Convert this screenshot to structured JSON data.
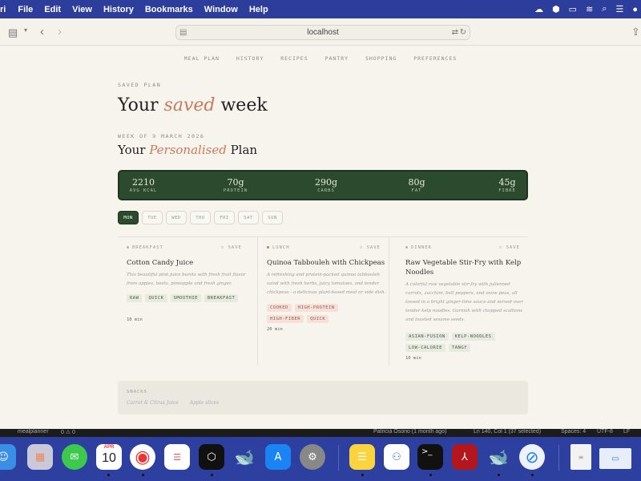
{
  "menubar": {
    "app": "ri",
    "items": [
      "File",
      "Edit",
      "View",
      "History",
      "Bookmarks",
      "Window",
      "Help"
    ]
  },
  "browser": {
    "url": "localhost"
  },
  "nav": {
    "items": [
      "MEAL PLAN",
      "HISTORY",
      "RECIPES",
      "PANTRY",
      "SHOPPING",
      "PREFERENCES"
    ]
  },
  "header": {
    "eyebrow": "SAVED PLAN",
    "title_pre": "Your ",
    "title_accent": "saved",
    "title_post": " week",
    "week_eyebrow": "WEEK OF 9 MARCH 2026",
    "subtitle_pre": "Your ",
    "subtitle_accent": "Personalised",
    "subtitle_post": " Plan"
  },
  "stats": [
    {
      "value": "2210",
      "label": "AVG KCAL"
    },
    {
      "value": "70g",
      "label": "PROTEIN"
    },
    {
      "value": "290g",
      "label": "CARBS"
    },
    {
      "value": "80g",
      "label": "FAT"
    },
    {
      "value": "45g",
      "label": "FIBRE"
    }
  ],
  "days": [
    "MON",
    "TUE",
    "WED",
    "THU",
    "FRI",
    "SAT",
    "SUN"
  ],
  "active_day": "MON",
  "meals": [
    {
      "category": "BREAKFAST",
      "dot_color": "#b9b39e",
      "save": "SAVE",
      "title": "Cotton Candy Juice",
      "desc": [
        "This beautiful pink juice bursts with fresh fruit flavor",
        "from apples, beets, pineapple and fresh ginger."
      ],
      "tags": [
        {
          "label": "RAW",
          "tone": "g"
        },
        {
          "label": "QUICK",
          "tone": "g"
        },
        {
          "label": "SMOOTHIE",
          "tone": "g"
        },
        {
          "label": "BREAKFAST",
          "tone": "g"
        }
      ],
      "time": "10 min"
    },
    {
      "category": "LUNCH",
      "dot_color": "#c97a5c",
      "save": "SAVE",
      "title": "Quinoa Tabbouleh with Chickpeas",
      "desc": [
        "A refreshing and protein-packed quinoa tabbouleh",
        "salad with fresh herbs, juicy tomatoes, and tender",
        "chickpeas - a delicious plant-based meal or side dish."
      ],
      "tags": [
        {
          "label": "COOKED",
          "tone": "r"
        },
        {
          "label": "HIGH-PROTEIN",
          "tone": "r"
        },
        {
          "label": "HIGH-FIBER",
          "tone": "r"
        },
        {
          "label": "QUICK",
          "tone": "r"
        }
      ],
      "time": "20 min"
    },
    {
      "category": "DINNER",
      "dot_color": "#b9b39e",
      "save": "SAVE",
      "title": "Raw Vegetable Stir-Fry with Kelp Noodles",
      "desc": [
        "A colorful raw vegetable stir-fry with julienned",
        "carrots, zucchini, bell peppers, and snow peas, all",
        "tossed in a bright ginger-lime sauce and served over",
        "tender kelp noodles. Garnish with chopped scallions",
        "and toasted sesame seeds."
      ],
      "tags": [
        {
          "label": "ASIAN-FUSION",
          "tone": "g"
        },
        {
          "label": "KELP-NOODLES",
          "tone": "g"
        },
        {
          "label": "LOW-CALORIE",
          "tone": "g"
        },
        {
          "label": "TANGY",
          "tone": "g"
        }
      ],
      "time": "10 min"
    }
  ],
  "snacks": {
    "label": "SNACKS",
    "items": [
      "Carrot & Citrus Juice",
      "Apple slices"
    ]
  },
  "statusbar": {
    "left": "mealplanner",
    "errors": "0 ⚠ 0",
    "blame": "Patricia Osorio (1 month ago)",
    "position": "Ln 140, Col 1 (37 selected)",
    "spaces": "Spaces: 4",
    "encoding": "UTF-8",
    "eol": "LF"
  },
  "dock": {
    "calendar_month": "APR",
    "calendar_day": "10"
  },
  "colors": {
    "accent": "#c97a5c",
    "forest": "#2c4a2e",
    "background": "#f7f4ee"
  }
}
